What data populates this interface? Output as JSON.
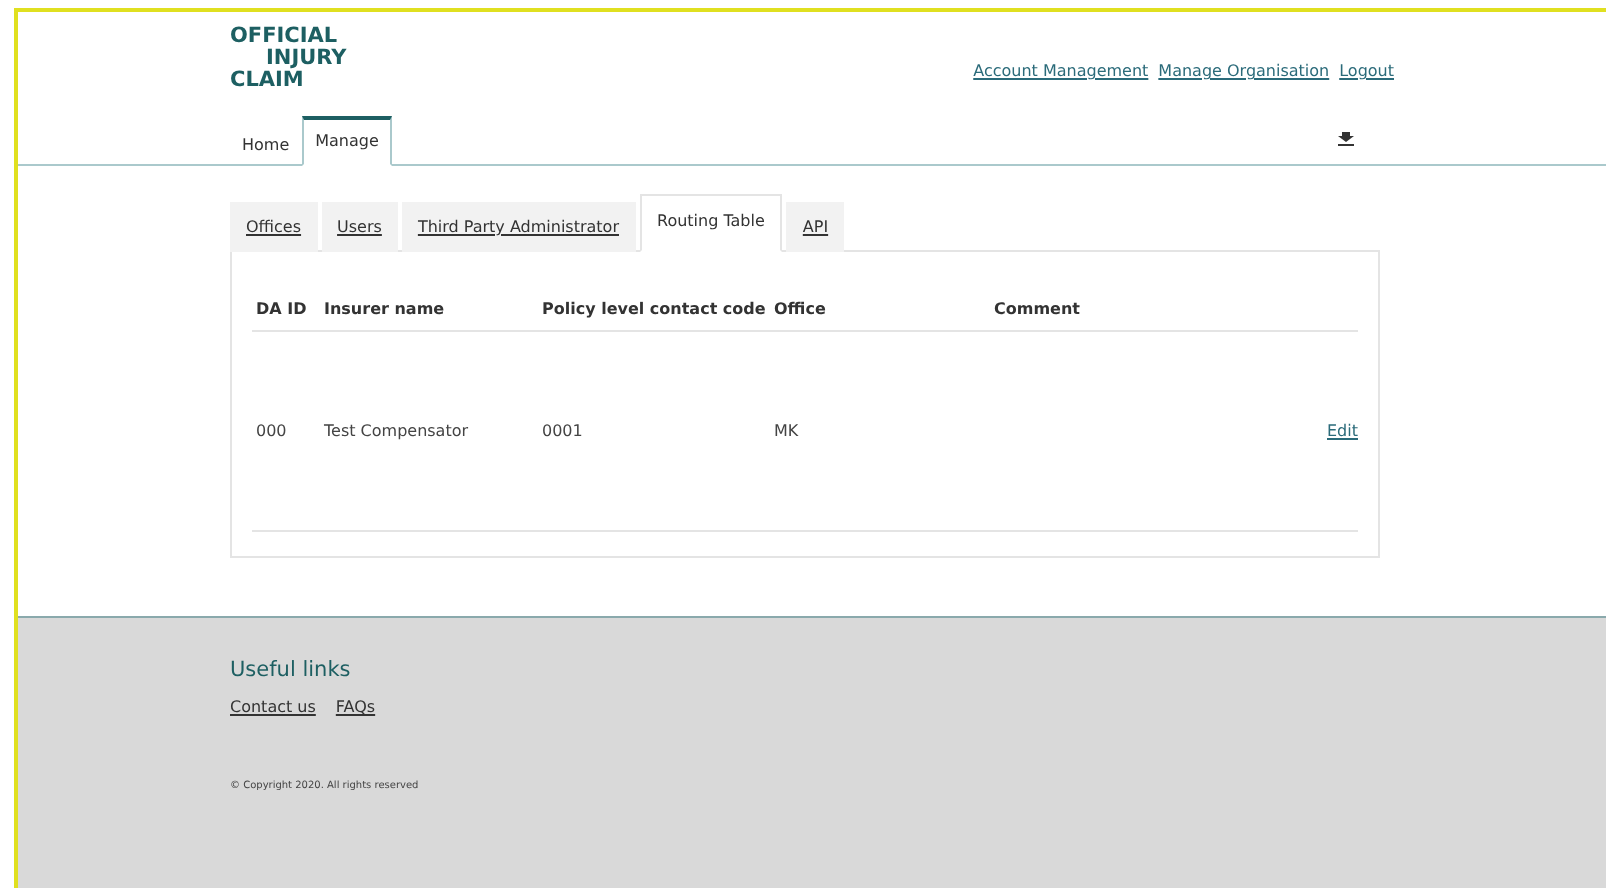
{
  "logo": {
    "lines": [
      "OFFICIAL",
      "INJURY",
      "CLAIM"
    ]
  },
  "top_links": [
    "Account Management",
    "Manage Organisation",
    "Logout"
  ],
  "main_tabs": [
    {
      "label": "Home",
      "selected": false
    },
    {
      "label": "Manage",
      "selected": true
    }
  ],
  "sub_tabs": [
    {
      "label": "Offices",
      "selected": false
    },
    {
      "label": "Users",
      "selected": false
    },
    {
      "label": "Third Party Administrator",
      "selected": false
    },
    {
      "label": "Routing Table",
      "selected": true
    },
    {
      "label": "API",
      "selected": false
    }
  ],
  "table": {
    "columns": [
      "DA ID",
      "Insurer name",
      "Policy level contact code",
      "Office",
      "Comment"
    ],
    "rows": [
      {
        "cells": [
          "000",
          "Test Compensator",
          "0001",
          "MK",
          ""
        ],
        "action": "Edit"
      }
    ]
  },
  "footer": {
    "heading": "Useful links",
    "links": [
      "Contact us",
      "FAQs"
    ],
    "copyright": "© Copyright 2020. All rights reserved"
  }
}
